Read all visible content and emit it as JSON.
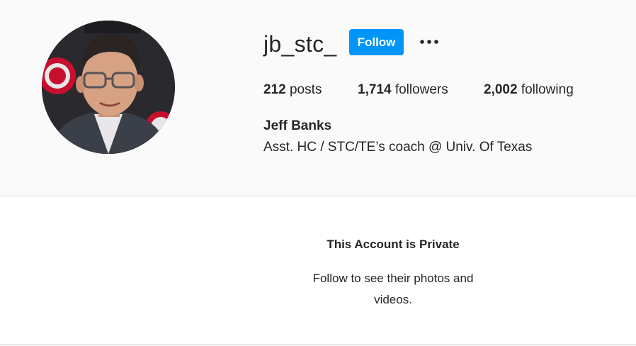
{
  "profile": {
    "username": "jb_stc_",
    "follow_label": "Follow",
    "more_icon": "ellipsis-icon",
    "avatar_icon": "profile-photo",
    "stats": {
      "posts_count": "212",
      "posts_label": "posts",
      "followers_count": "1,714",
      "followers_label": "followers",
      "following_count": "2,002",
      "following_label": "following"
    },
    "full_name": "Jeff Banks",
    "bio": "Asst. HC / STC/TE’s coach @ Univ. Of Texas"
  },
  "private_notice": {
    "title": "This Account is Private",
    "description": "Follow to see their photos and videos."
  },
  "colors": {
    "accent": "#0095f6",
    "header_bg": "#fafafa",
    "panel_bg": "#ffffff",
    "text": "#262626",
    "border": "#dbdbdb"
  }
}
